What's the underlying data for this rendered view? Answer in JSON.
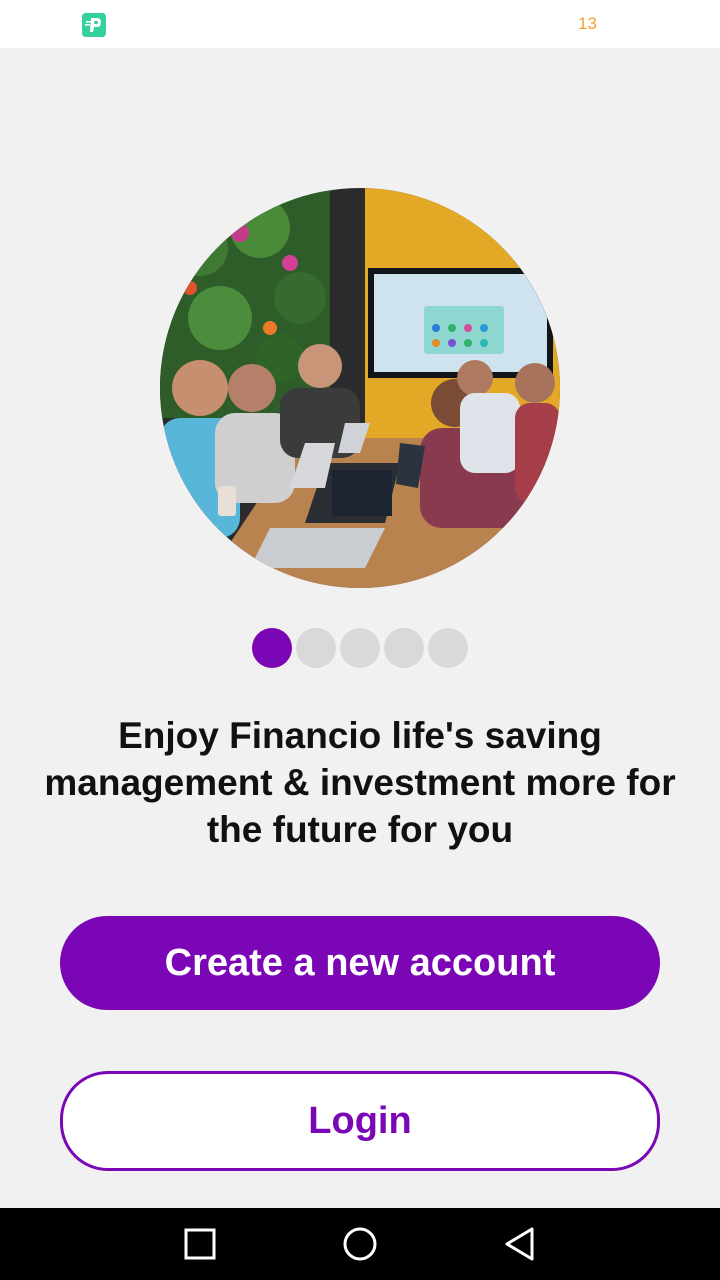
{
  "status_bar": {
    "time": "13",
    "app_icon": "financio-app-icon"
  },
  "hero": {
    "image": "team-working-on-laptops-photo"
  },
  "pager": {
    "count": 5,
    "active_index": 0,
    "active_color": "#7b06b5",
    "inactive_color": "#d9d9d9"
  },
  "tagline": "Enjoy Financio life's saving management & investment more for the future for you",
  "buttons": {
    "create_account": "Create a new account",
    "login": "Login"
  },
  "nav_bar": {
    "recents_icon": "square-icon",
    "home_icon": "circle-icon",
    "back_icon": "triangle-back-icon"
  },
  "colors": {
    "accent": "#7b06b5",
    "background": "#f1f1f1"
  }
}
